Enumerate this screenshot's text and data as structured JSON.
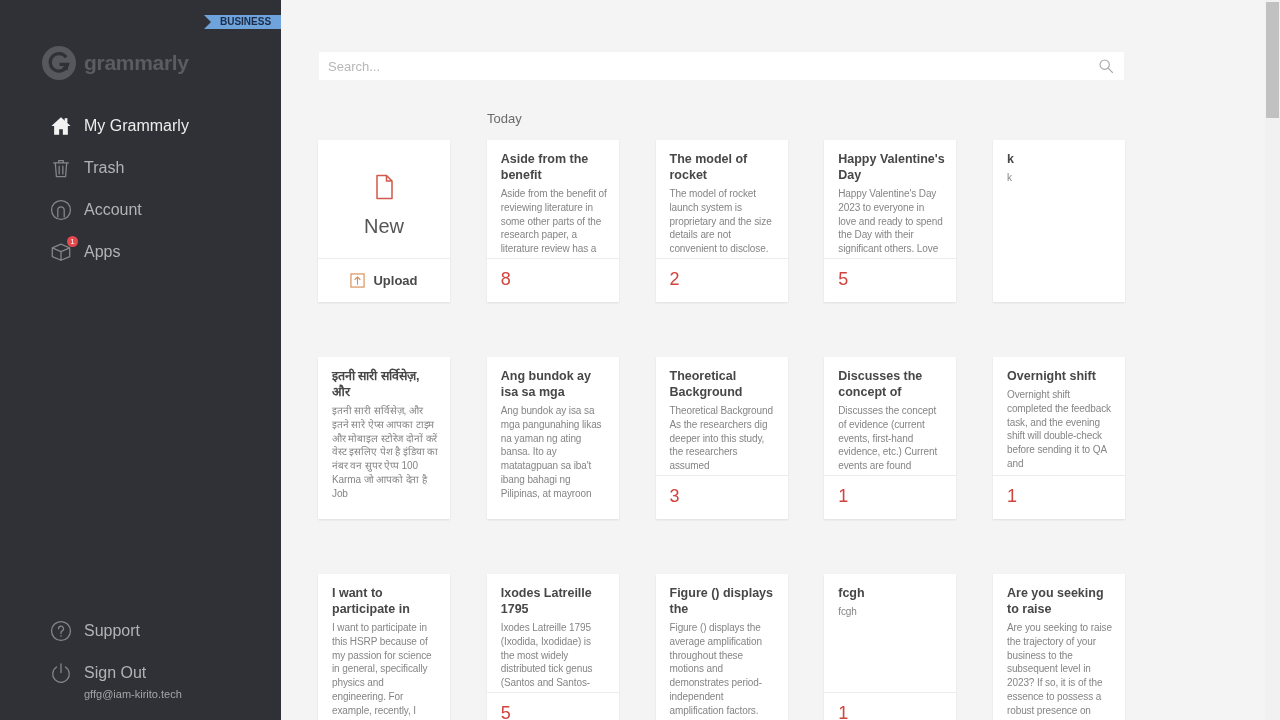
{
  "sidebar": {
    "plan_badge": "BUSINESS",
    "logo": "grammarly",
    "items": [
      {
        "label": "My Grammarly",
        "selected": true
      },
      {
        "label": "Trash",
        "selected": false
      },
      {
        "label": "Account",
        "selected": false
      },
      {
        "label": "Apps",
        "selected": false,
        "badge": "1"
      }
    ],
    "footer_items": [
      {
        "label": "Support"
      },
      {
        "label": "Sign Out"
      }
    ],
    "account_email": "gffg@iam-kirito.tech"
  },
  "search": {
    "placeholder": "Search..."
  },
  "section_label": "Today",
  "new_document": {
    "label": "New",
    "upload_label": "Upload"
  },
  "documents": [
    {
      "title": "Aside from the benefit",
      "preview": "Aside from the benefit of reviewing literature in some other parts of the research paper, a literature review has a",
      "count": "8"
    },
    {
      "title": "The model of rocket",
      "preview": "The model of rocket launch system is proprietary and the size details are not convenient to disclose.",
      "count": "2"
    },
    {
      "title": "Happy Valentine's Day",
      "preview": "Happy Valentine's Day 2023 to everyone in love and ready to spend the Day with their significant others. Love",
      "count": "5"
    },
    {
      "title": "k",
      "preview": "k"
    },
    {
      "title": "इतनी सारी सर्विसेज़, और",
      "preview": "इतनी सारी सर्विसेज़, और इतने सारे ऐप्स आपका टाइम और मोबाइल स्टोरेज दोनों करें वेस्ट इसलिए पेश है इंडिया का नंबर वन सुपर ऐप्प 100 Karma जो आपको देता है Job"
    },
    {
      "title": "Ang bundok ay isa sa mga",
      "preview": "Ang bundok ay isa sa mga pangunahing likas na yaman ng ating bansa. Ito ay matatagpuan sa iba't ibang bahagi ng Pilipinas, at mayroon"
    },
    {
      "title": "Theoretical Background",
      "preview": "Theoretical Background As the researchers dig deeper into this study, the researchers assumed",
      "count": "3"
    },
    {
      "title": "Discusses the concept of",
      "preview": "Discusses the concept of evidence (current events, first-hand evidence, etc.) Current events are found",
      "count": "1"
    },
    {
      "title": "Overnight shift",
      "preview": "Overnight shift completed the feedback task, and the evening shift will double-check before sending it to QA and",
      "count": "1"
    },
    {
      "title": "I want to participate in",
      "preview": "I want to participate in this HSRP because of my passion for science in general, specifically physics and engineering. For example, recently, I"
    },
    {
      "title": "Ixodes Latreille 1795",
      "preview": "Ixodes Latreille 1795 (Ixodida, Ixodidae) is the most widely distributed tick genus (Santos and Santos-",
      "count": "5"
    },
    {
      "title": "Figure () displays the",
      "preview": "Figure () displays the average amplification throughout these motions and demonstrates period-independent amplification factors."
    },
    {
      "title": "fcgh",
      "preview": "fcgh",
      "count": "1"
    },
    {
      "title": "Are you seeking to raise",
      "preview": "Are you seeking to raise the trajectory of your business to the subsequent level in 2023? If so, it is of the essence to possess a robust presence on"
    }
  ]
}
